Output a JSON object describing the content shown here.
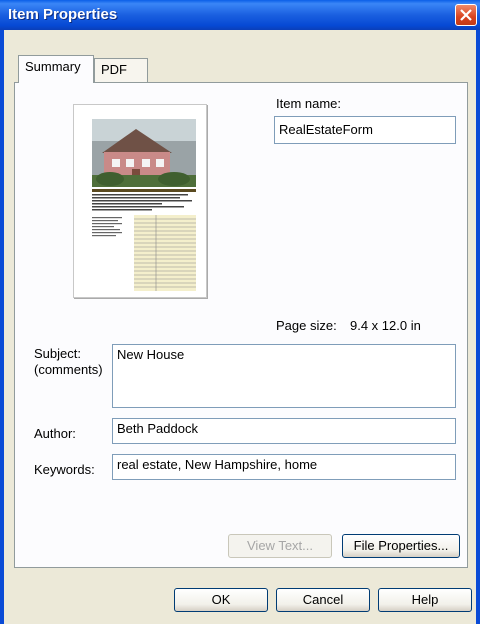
{
  "window": {
    "title": "Item Properties"
  },
  "tabs": [
    {
      "label": "Summary"
    },
    {
      "label": "PDF"
    }
  ],
  "item_name": {
    "label": "Item name:",
    "value": "RealEstateForm"
  },
  "page_size": {
    "label": "Page size:",
    "value": "9.4 x 12.0 in"
  },
  "subject": {
    "label_line1": "Subject:",
    "label_line2": "(comments)",
    "value": "New House"
  },
  "author": {
    "label": "Author:",
    "value": "Beth Paddock"
  },
  "keywords": {
    "label": "Keywords:",
    "value": "real estate, New Hampshire, home"
  },
  "buttons": {
    "view_text": "View Text...",
    "file_properties": "File Properties...",
    "ok": "OK",
    "cancel": "Cancel",
    "help": "Help"
  },
  "icons": {
    "close": "close-x-icon"
  }
}
